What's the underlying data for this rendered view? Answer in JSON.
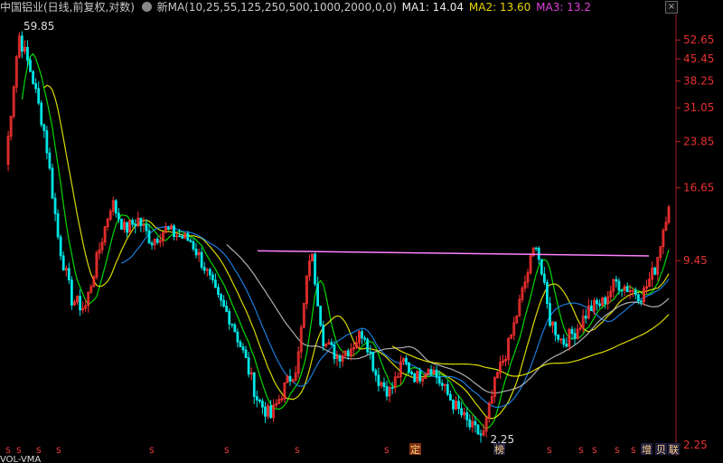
{
  "header": {
    "stock_title": "中国铝业(日线,前复权,对数)",
    "formula": "新MA(10,25,55,125,250,500,1000,2000,0,0)",
    "ma1": "MA1: 14.04",
    "ma2": "MA2: 13.60",
    "ma3": "MA3: 13.2"
  },
  "chart_data": {
    "type": "candlestick",
    "y_scale": "log",
    "ylim": [
      2.25,
      59.85
    ],
    "y_ticks": [
      "52.65",
      "45.45",
      "38.25",
      "31.05",
      "23.85",
      "16.65",
      "9.45",
      "2.25"
    ],
    "annotations": {
      "high": "59.85",
      "low": "2.25"
    },
    "colors": {
      "up": "#ff3232",
      "down": "#00e5e5",
      "ma1": "#ffffff",
      "ma2": "#ffff00",
      "ma3": "#ff00ff",
      "ma4": "#00ff00",
      "ma5": "#1e90ff",
      "ma6": "#cccccc",
      "trendline": "#ff80ff"
    },
    "series": [
      {
        "name": "close",
        "x": [
          0,
          2,
          4,
          6,
          8,
          10,
          12,
          14,
          16,
          18,
          20,
          22,
          24,
          26,
          28,
          30,
          32,
          34,
          36,
          38,
          40,
          42,
          44,
          46,
          48,
          50,
          52,
          54,
          56,
          58,
          60,
          62,
          64,
          66,
          68,
          70,
          72,
          74,
          76,
          78,
          80,
          82,
          84,
          86,
          88,
          90,
          92,
          94,
          96,
          98,
          100
        ],
        "values": [
          20,
          55,
          40,
          25,
          11,
          7,
          6.5,
          10,
          15,
          12,
          13,
          11,
          12,
          11.5,
          11,
          9,
          7,
          6,
          4.5,
          3.2,
          2.8,
          3.5,
          4.2,
          10.5,
          5,
          4.5,
          4.8,
          5.5,
          3.8,
          3.4,
          4.3,
          3.8,
          4.2,
          3.5,
          3,
          2.6,
          2.4,
          3.8,
          5,
          7.5,
          11,
          6,
          5,
          5.5,
          6.5,
          6.8,
          8,
          7.6,
          7.2,
          9,
          15
        ]
      }
    ],
    "trendline": {
      "from": [
        38,
        10.2
      ],
      "to": [
        97,
        9.8
      ]
    }
  },
  "markers": {
    "bottom_labels": [
      "S",
      "S",
      "S",
      "S",
      "S",
      "S",
      "S",
      "S",
      "S",
      "S",
      "S",
      "S",
      "S",
      "S"
    ],
    "special_labels": [
      "定",
      "榜",
      "增",
      "贝",
      "联"
    ]
  },
  "footer": {
    "text": "VOL-VMA"
  }
}
